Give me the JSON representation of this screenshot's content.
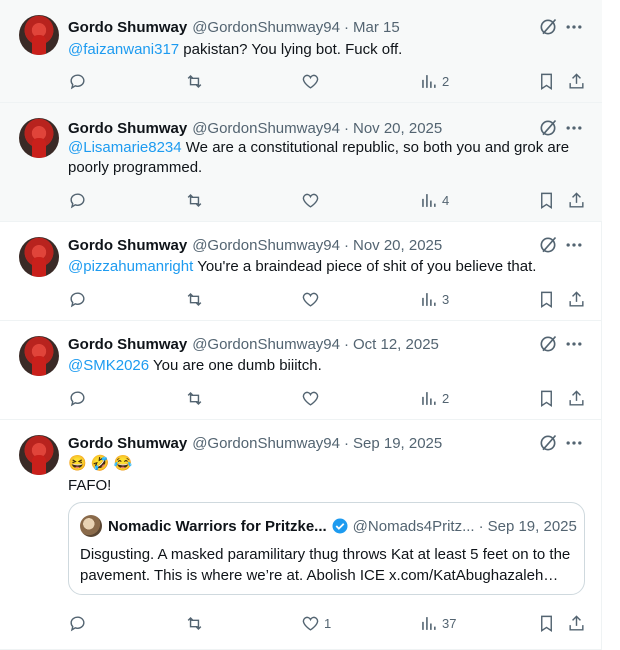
{
  "author": {
    "name": "Gordo Shumway",
    "handle": "@GordonShumway94"
  },
  "posts": [
    {
      "date": "Mar 15",
      "mention": "@faizanwani317",
      "text": " pakistan? You lying bot. Fuck off.",
      "views": "2",
      "likes": ""
    },
    {
      "date": "Nov 20, 2025",
      "mention": "@Lisamarie8234",
      "text": " We are a constitutional republic, so both you and grok are poorly programmed.",
      "views": "4",
      "likes": ""
    },
    {
      "date": "Nov 20, 2025",
      "mention": "@pizzahumanright",
      "text": " You're a braindead piece of shit of you believe that.",
      "views": "3",
      "likes": ""
    },
    {
      "date": "Oct 12, 2025",
      "mention": "@SMK2026",
      "text": " You are one dumb biiitch.",
      "views": "2",
      "likes": ""
    },
    {
      "date": "Sep 19, 2025",
      "mention": "",
      "emoji": "😆 🤣 😂",
      "text": "FAFO!",
      "views": "37",
      "likes": "1",
      "quote": {
        "name": "Nomadic Warriors for Pritzke...",
        "handle": "@Nomads4Pritz...",
        "date": "Sep 19, 2025",
        "text": "Disgusting. A masked paramilitary thug throws Kat at least 5 feet on to the pavement. This is where we’re at. Abolish ICE x.com/KatAbughazaleh…"
      }
    }
  ],
  "separator": "·",
  "colors": {
    "link": "#1d9bf0",
    "muted": "#536471",
    "verified": "#1d9bf0"
  },
  "icons": [
    "reply-icon",
    "repost-icon",
    "like-icon",
    "views-icon",
    "bookmark-icon",
    "share-icon",
    "grok-icon",
    "more-icon",
    "verified-icon"
  ]
}
